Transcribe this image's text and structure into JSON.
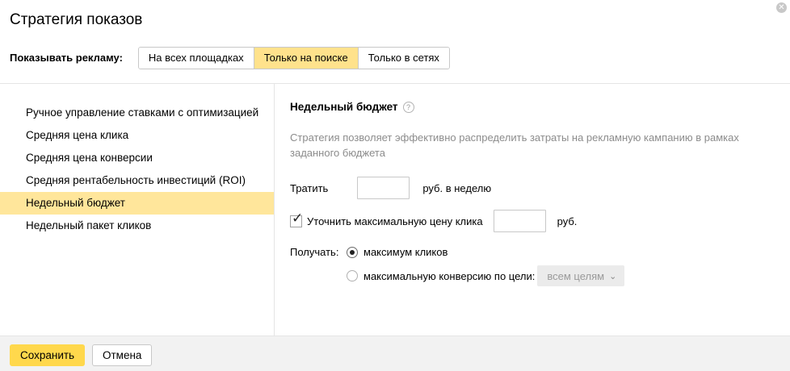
{
  "dialog": {
    "title": "Стратегия показов"
  },
  "show_ads": {
    "label": "Показывать рекламу:",
    "options": [
      "На всех площадках",
      "Только на поиске",
      "Только в сетях"
    ],
    "selected": "Только на поиске"
  },
  "strategies": {
    "items": [
      "Ручное управление ставками с оптимизацией",
      "Средняя цена клика",
      "Средняя цена конверсии",
      "Средняя рентабельность инвестиций (ROI)",
      "Недельный бюджет",
      "Недельный пакет кликов"
    ],
    "selected": "Недельный бюджет"
  },
  "panel": {
    "title": "Недельный бюджет",
    "help_icon_glyph": "?",
    "description": "Стратегия позволяет эффективно распределить затраты на рекламную кампанию в рамках заданного бюджета",
    "spend": {
      "label": "Тратить",
      "value": "",
      "unit": "руб. в неделю"
    },
    "max_price": {
      "checked": true,
      "label": "Уточнить максимальную цену клика",
      "value": "",
      "unit": "руб."
    },
    "receive": {
      "label": "Получать:",
      "options": [
        {
          "label": "максимум кликов",
          "checked": true
        },
        {
          "label": "максимальную конверсию по цели:",
          "checked": false
        }
      ],
      "goal_select": "всем целям"
    }
  },
  "footer": {
    "save": "Сохранить",
    "cancel": "Отмена"
  },
  "icons": {
    "close": "close-icon",
    "help": "question-icon",
    "check": "checkmark-icon",
    "chevron": "chevron-down-icon"
  },
  "colors": {
    "accent": "#ffd84c",
    "selected_bg": "#ffe69b",
    "segment_active": "#ffe28c"
  }
}
